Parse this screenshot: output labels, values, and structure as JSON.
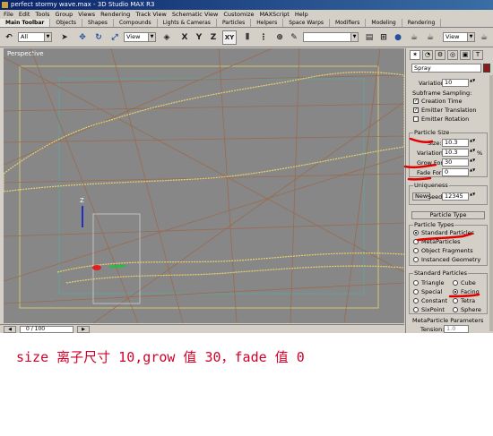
{
  "window": {
    "title": "perfect stormy wave.max - 3D Studio MAX R3"
  },
  "menu": [
    "File",
    "Edit",
    "Tools",
    "Group",
    "Views",
    "Rendering",
    "Track View",
    "Schematic View",
    "Customize",
    "MAXScript",
    "Help"
  ],
  "tabs": [
    "Main Toolbar",
    "Objects",
    "Shapes",
    "Compounds",
    "Lights & Cameras",
    "Particles",
    "Helpers",
    "Space Warps",
    "Modifiers",
    "Modeling",
    "Rendering"
  ],
  "toolbar": {
    "selection_filter": "All",
    "coord_system": "View",
    "axis_x": "X",
    "axis_y": "Y",
    "axis_z": "Z",
    "axis_xy": "XY",
    "right_view": "View"
  },
  "viewport": {
    "label": "Perspective"
  },
  "timeline": {
    "value": "0 / 100"
  },
  "panel": {
    "object_name": "Spray",
    "variation_top_label": "Variation:",
    "variation_top_value": "10",
    "subframe_title": "Subframe Sampling:",
    "creation_time": "Creation Time",
    "emitter_translation": "Emitter Translation",
    "emitter_rotation": "Emitter Rotation",
    "particle_size_title": "Particle Size",
    "size_label": "Size:",
    "size_value": "10.3",
    "variation_label": "Variation:",
    "variation_value": "10.3",
    "grow_label": "Grow For:",
    "grow_value": "30",
    "fade_label": "Fade For:",
    "fade_value": "0",
    "uniqueness_title": "Uniqueness",
    "new_button": "New",
    "seed_label": "Seed:",
    "seed_value": "12345",
    "particle_type_rollout": "Particle Type",
    "particle_types_title": "Particle Types",
    "type_standard": "Standard Particles",
    "type_metaball": "MetaParticles",
    "type_fragments": "Object Fragments",
    "type_instanced": "Instanced Geometry",
    "standard_title": "Standard Particles",
    "opt_triangle": "Triangle",
    "opt_cube": "Cube",
    "opt_special": "Special",
    "opt_facing": "Facing",
    "opt_constant": "Constant",
    "opt_tetra": "Tetra",
    "opt_sixpoint": "SixPoint",
    "opt_sphere": "Sphere",
    "meta_title": "MetaParticle Parameters",
    "tension_label": "Tension:",
    "tension_value": "1.0"
  },
  "caption": "size 离子尺寸 10,grow 值 30，fade 值 0"
}
